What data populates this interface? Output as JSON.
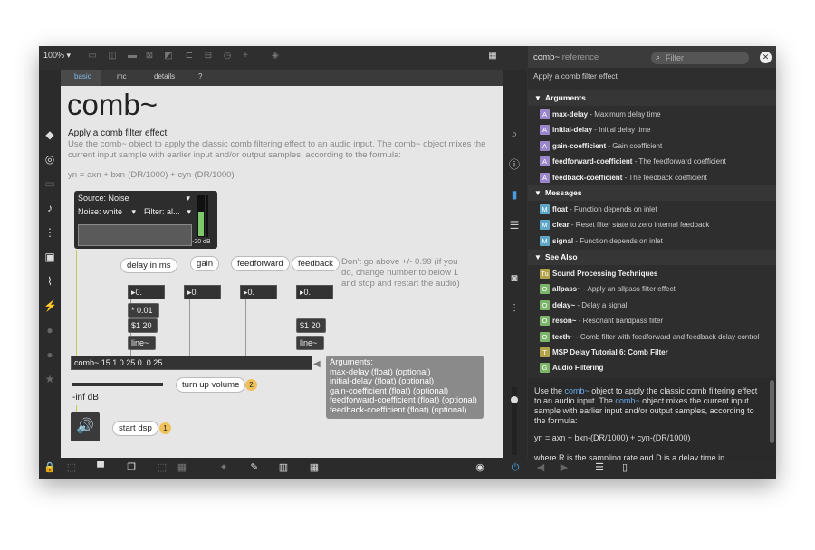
{
  "toolbar": {
    "zoom": "100% ▾"
  },
  "tabs": [
    "basic",
    "mc",
    "details",
    "?"
  ],
  "patch": {
    "title": "comb~",
    "subtitle": "Apply a comb filter effect",
    "description": "Use the comb~ object to apply the classic comb filtering effect to an audio input. The comb~ object mixes the current input sample with earlier input and/or output samples, according to the formula:",
    "formula": "yn = axn + bxn-(DR/1000) + cyn-(DR/1000)",
    "source_label": "Source: Noise",
    "noise_label": "Noise: white",
    "filter_label": "Filter: al...",
    "meter_db": "-20 dB",
    "bubbles": {
      "delay": "delay in ms",
      "gain": "gain",
      "feedforward": "feedforward",
      "feedback": "feedback"
    },
    "numbers": {
      "delay": "0.",
      "gain": "0.",
      "feedforward": "0.",
      "feedback": "0."
    },
    "msg_mul": "* 0.01",
    "msg_ramp1": "$1 20",
    "msg_line1": "line~",
    "msg_ramp2": "$1 20",
    "msg_line2": "line~",
    "comb_object": "comb~ 15 1 0.25 0. 0.25",
    "note": "Don't go above +/- 0.99 (if you do, change number to below 1 and stop and restart the audio)",
    "args_title": "Arguments:",
    "args_lines": [
      "max-delay (float) (optional)",
      "initial-delay (float) (optional)",
      "gain-coefficient (float) (optional)",
      "feedforward-coefficient (float) (optional)",
      "feedback-coefficient (float) (optional)"
    ],
    "turn_up": "turn up volume",
    "turn_up_badge": "2",
    "inf_db": "-inf dB",
    "start_dsp": "start dsp",
    "start_badge": "1"
  },
  "reference": {
    "title": "comb~",
    "title_suffix": "reference",
    "filter_placeholder": "Filter",
    "intro": "Apply a comb filter effect",
    "sections": {
      "arguments": "Arguments",
      "messages": "Messages",
      "see_also": "See Also"
    },
    "arguments": [
      {
        "icon": "A",
        "name": "max-delay",
        "desc": " - Maximum delay time"
      },
      {
        "icon": "A",
        "name": "initial-delay",
        "desc": " - Initial delay time"
      },
      {
        "icon": "A",
        "name": "gain-coefficient",
        "desc": " - Gain coefficient"
      },
      {
        "icon": "A",
        "name": "feedforward-coefficient",
        "desc": " - The feedforward coefficient"
      },
      {
        "icon": "A",
        "name": "feedback-coefficient",
        "desc": " - The feedback coefficient"
      }
    ],
    "messages": [
      {
        "icon": "M",
        "name": "float",
        "desc": " - Function depends on inlet"
      },
      {
        "icon": "M",
        "name": "clear",
        "desc": " - Reset filter state to zero internal feedback"
      },
      {
        "icon": "M",
        "name": "signal",
        "desc": " - Function depends on inlet"
      }
    ],
    "see_also": [
      {
        "icon": "Tu",
        "name": "Sound Processing Techniques",
        "desc": ""
      },
      {
        "icon": "O",
        "name": "allpass~",
        "desc": " - Apply an allpass filter effect"
      },
      {
        "icon": "O",
        "name": "delay~",
        "desc": " - Delay a signal"
      },
      {
        "icon": "O",
        "name": "reson~",
        "desc": " - Resonant bandpass filter"
      },
      {
        "icon": "O",
        "name": "teeth~",
        "desc": " - Comb filter with feedforward and feedback delay control"
      },
      {
        "icon": "T",
        "name": "MSP Delay Tutorial 6: Comb Filter",
        "desc": ""
      },
      {
        "icon": "G",
        "name": "Audio Filtering",
        "desc": ""
      }
    ],
    "body_p1_a": "Use the ",
    "body_p1_b": "comb~",
    "body_p1_c": " object to apply the classic comb filtering effect to an audio input. The ",
    "body_p1_d": "comb~",
    "body_p1_e": " object mixes the current input sample with earlier input and/or output samples, according to the formula:",
    "body_formula": "yn = axn + bxn-(DR/1000) + cyn-(DR/1000)",
    "body_p2": "where R is the sampling rate and D is a delay time in"
  },
  "colors": {
    "arg_icon": "#9a87c9",
    "msg_icon": "#5fa7c9",
    "obj_icon": "#7cb46a",
    "tut_icon": "#b2a24a",
    "accent": "#4a9ee0"
  }
}
